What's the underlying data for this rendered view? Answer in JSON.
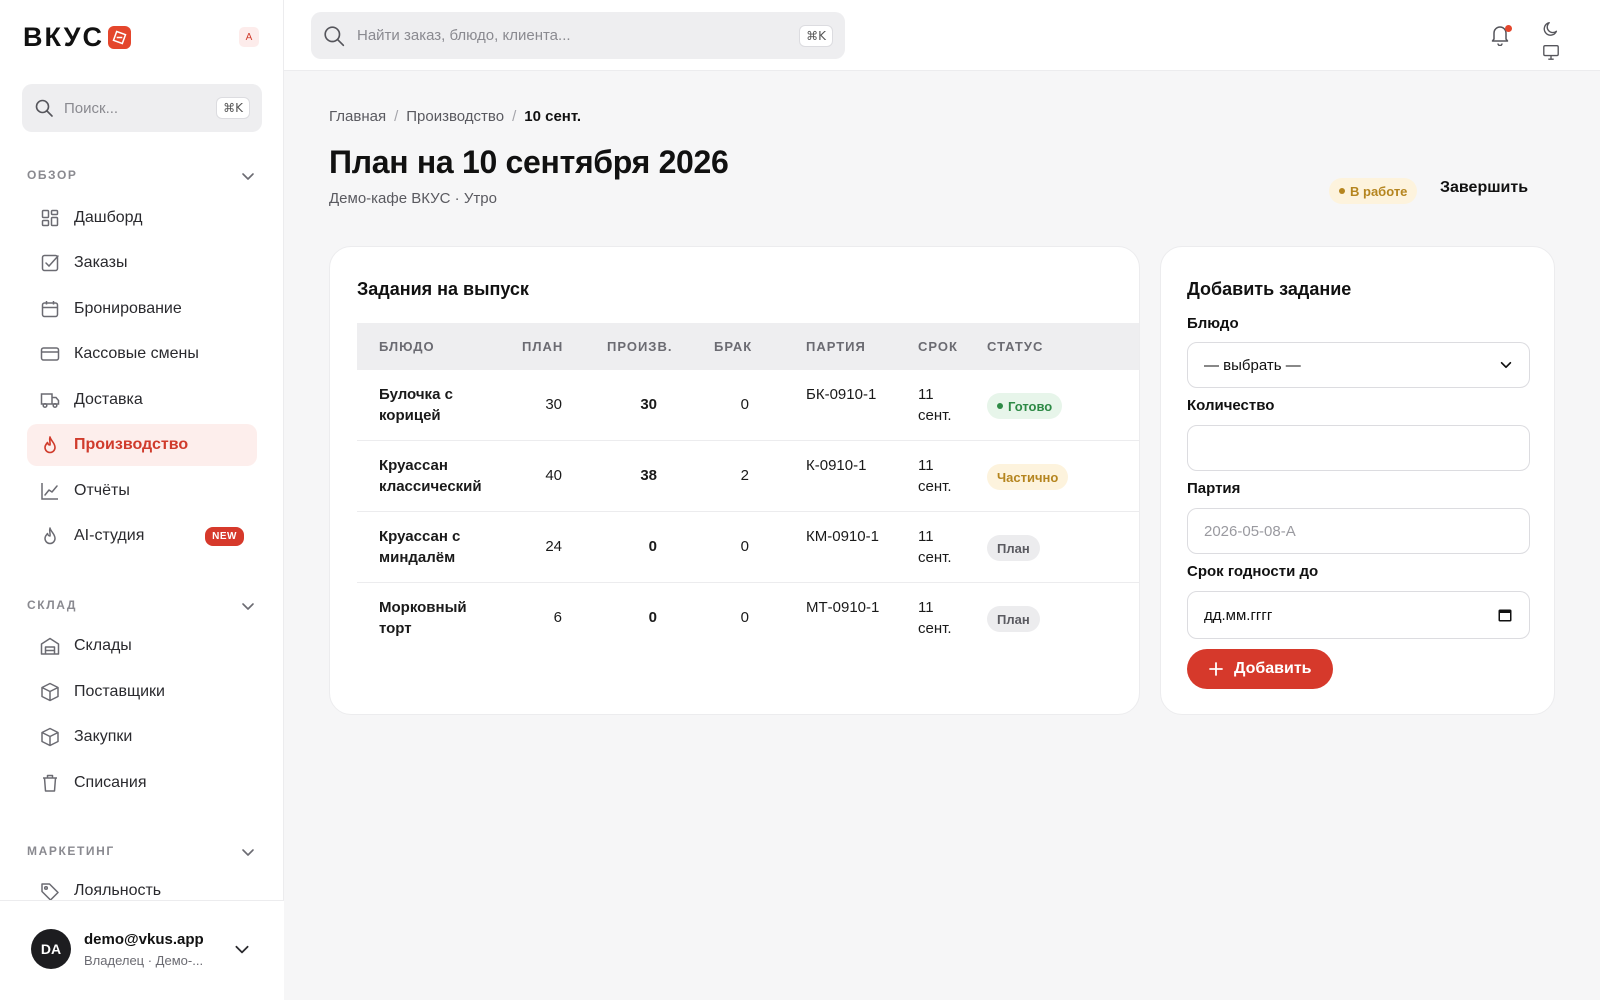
{
  "brand": {
    "name": "ВКУС",
    "accent": "#d6392b"
  },
  "user_chip": "A",
  "sidebar": {
    "search_placeholder": "Поиск...",
    "search_kbd": "⌘K",
    "sections": [
      {
        "label": "ОБЗОР"
      },
      {
        "label": "СКЛАД"
      },
      {
        "label": "МАРКЕТИНГ"
      }
    ],
    "items": [
      {
        "label": "Дашборд",
        "icon": "dashboard-icon"
      },
      {
        "label": "Заказы",
        "icon": "checkbox-icon"
      },
      {
        "label": "Бронирование",
        "icon": "calendar-icon"
      },
      {
        "label": "Кассовые смены",
        "icon": "card-icon"
      },
      {
        "label": "Доставка",
        "icon": "truck-icon"
      },
      {
        "label": "Производство",
        "icon": "flame-icon",
        "active": true
      },
      {
        "label": "Отчёты",
        "icon": "chart-icon"
      },
      {
        "label": "AI-студия",
        "icon": "flame-icon",
        "badge": "NEW"
      },
      {
        "label": "Склады",
        "icon": "warehouse-icon"
      },
      {
        "label": "Поставщики",
        "icon": "box-icon"
      },
      {
        "label": "Закупки",
        "icon": "box-icon"
      },
      {
        "label": "Списания",
        "icon": "trash-icon"
      },
      {
        "label": "Лояльность",
        "icon": "tag-icon"
      }
    ],
    "footer": {
      "initials": "DA",
      "email": "demo@vkus.app",
      "role": "Владелец · Демо-..."
    }
  },
  "topbar": {
    "search_placeholder": "Найти заказ, блюдо, клиента...",
    "search_kbd": "⌘K"
  },
  "breadcrumb": {
    "home": "Главная",
    "section": "Производство",
    "current": "10 сент."
  },
  "page": {
    "title": "План на 10 сентября 2026",
    "subtitle": "Демо-кафе ВКУС · Утро",
    "status": "В работе",
    "finish_label": "Завершить"
  },
  "tasks": {
    "title": "Задания на выпуск",
    "columns": {
      "dish": "БЛЮДО",
      "plan": "ПЛАН",
      "produced": "ПРОИЗВ.",
      "defect": "БРАК",
      "batch": "ПАРТИЯ",
      "term": "СРОК",
      "status": "СТАТУС"
    },
    "rows": [
      {
        "dish": "Булочка с корицей",
        "plan": "30",
        "produced": "30",
        "defect": "0",
        "batch": "БК-0910-1",
        "term": "11 сент.",
        "status": "Готово",
        "status_kind": "done"
      },
      {
        "dish": "Круассан классический",
        "plan": "40",
        "produced": "38",
        "defect": "2",
        "batch": "К-0910-1",
        "term": "11 сент.",
        "status": "Частично",
        "status_kind": "partial"
      },
      {
        "dish": "Круассан с миндалём",
        "plan": "24",
        "produced": "0",
        "defect": "0",
        "batch": "КМ-0910-1",
        "term": "11 сент.",
        "status": "План",
        "status_kind": "plan"
      },
      {
        "dish": "Морковный торт",
        "plan": "6",
        "produced": "0",
        "defect": "0",
        "batch": "МТ-0910-1",
        "term": "11 сент.",
        "status": "План",
        "status_kind": "plan"
      }
    ]
  },
  "add_form": {
    "title": "Добавить задание",
    "dish_label": "Блюдо",
    "dish_value": "— выбрать —",
    "qty_label": "Количество",
    "qty_value": "",
    "batch_label": "Партия",
    "batch_placeholder": "2026-05-08-A",
    "expiry_label": "Срок годности до",
    "expiry_placeholder": "дд.мм.гггг",
    "submit_label": "Добавить"
  }
}
